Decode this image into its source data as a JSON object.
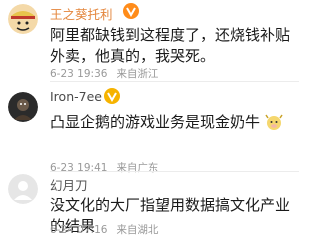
{
  "comments": [
    {
      "username": "王之葵托利",
      "text": "阿里都缺钱到这程度了，还烧钱补贴外卖，他真的，我哭死。",
      "time": "6-23 19:36",
      "location": "来自浙江",
      "avatar_icon": "one-piece-luffy-avatar-icon",
      "badge_icon": "orange-v-badge-icon",
      "username_color": "#e4853b"
    },
    {
      "username": "Iron-7ee",
      "text": "凸显企鹅的游戏业务是现金奶牛",
      "time": "6-23 19:41",
      "location": "来自广东",
      "avatar_icon": "dark-character-avatar-icon",
      "badge_icon": "gold-v-badge-icon",
      "emoji_icon": "cow-emoji-icon"
    },
    {
      "username": "幻月刀",
      "text": "没文化的大厂指望用数据搞文化产业的结果",
      "time": "6-24 07:16",
      "location": "来自湖北",
      "avatar_icon": "default-user-avatar-icon"
    }
  ]
}
